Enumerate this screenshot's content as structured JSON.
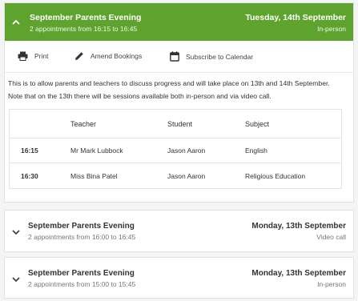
{
  "evenings": [
    {
      "title": "September Parents Evening",
      "subtitle": "2 appointments from 16:15 to 16:45",
      "date": "Tuesday, 14th September",
      "mode": "In-person",
      "expanded": true
    },
    {
      "title": "September Parents Evening",
      "subtitle": "2 appointments from 16:00 to 16:45",
      "date": "Monday, 13th September",
      "mode": "Video call",
      "expanded": false
    },
    {
      "title": "September Parents Evening",
      "subtitle": "2 appointments from 15:00 to 15:45",
      "date": "Monday, 13th September",
      "mode": "In-person",
      "expanded": false
    }
  ],
  "toolbar": {
    "print_label": "Print",
    "amend_label": "Amend Bookings",
    "calendar_label": "Subscribe to Calendar"
  },
  "description": "This is to allow parents and teachers to discuss progress and will take place on 13th and 14th September. Note that on the 13th there will be sessions available both in-person and via video call.",
  "table": {
    "headers": {
      "teacher": "Teacher",
      "student": "Student",
      "subject": "Subject"
    },
    "rows": [
      {
        "time": "16:15",
        "teacher": "Mr Mark Lubbock",
        "student": "Jason Aaron",
        "subject": "English"
      },
      {
        "time": "16:30",
        "teacher": "Miss Bina Patel",
        "student": "Jason Aaron",
        "subject": "Religious Education"
      }
    ]
  },
  "colors": {
    "header_green": "#5ea32e",
    "background": "#f4f4f4"
  },
  "icons": {
    "expanded_chevron": "chevron-up-icon",
    "collapsed_chevron": "chevron-down-icon",
    "print": "printer-icon",
    "amend": "pencil-icon",
    "calendar": "calendar-icon"
  }
}
